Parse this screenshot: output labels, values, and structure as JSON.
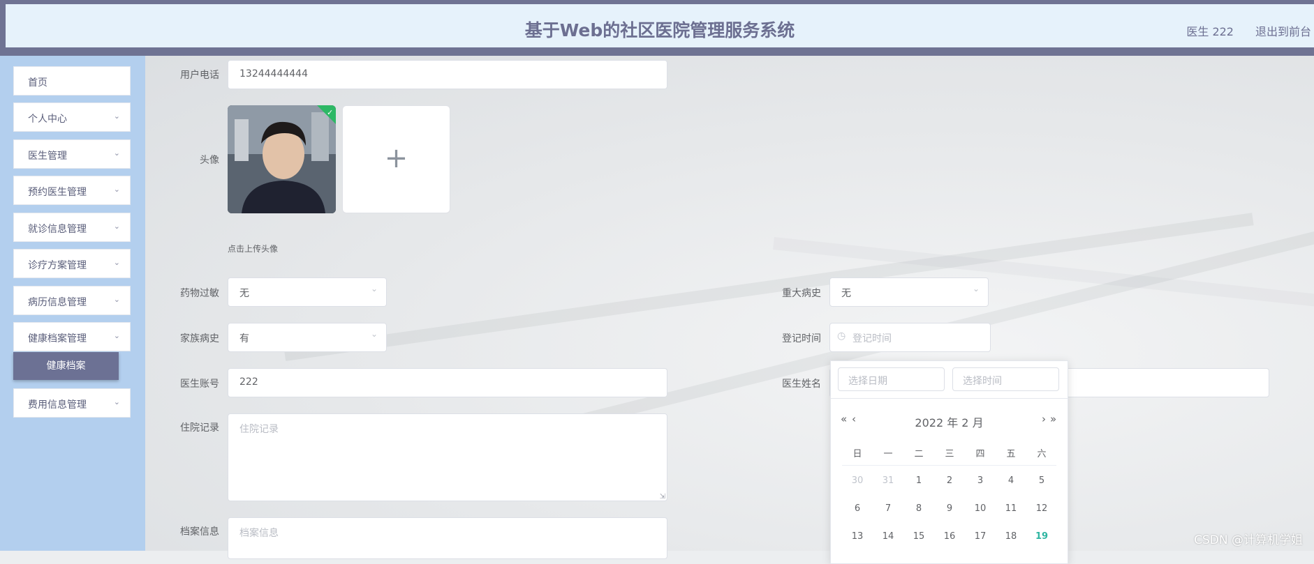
{
  "header": {
    "title": "基于Web的社区医院管理服务系统",
    "user": "医生 222",
    "logout": "退出到前台"
  },
  "sidebar": {
    "items": [
      {
        "label": "首页",
        "expandable": false
      },
      {
        "label": "个人中心",
        "expandable": true
      },
      {
        "label": "医生管理",
        "expandable": true
      },
      {
        "label": "预约医生管理",
        "expandable": true
      },
      {
        "label": "就诊信息管理",
        "expandable": true
      },
      {
        "label": "诊疗方案管理",
        "expandable": true
      },
      {
        "label": "病历信息管理",
        "expandable": true
      },
      {
        "label": "健康档案管理",
        "expandable": true
      },
      {
        "label": "费用信息管理",
        "expandable": true
      }
    ],
    "active_sub": "健康档案"
  },
  "form": {
    "phone": {
      "label": "用户电话",
      "value": "13244444444"
    },
    "avatar": {
      "label": "头像",
      "hint": "点击上传头像"
    },
    "allergy": {
      "label": "药物过敏",
      "value": "无"
    },
    "major_history": {
      "label": "重大病史",
      "value": "无"
    },
    "family_history": {
      "label": "家族病史",
      "value": "有"
    },
    "register_time": {
      "label": "登记时间",
      "placeholder": "登记时间"
    },
    "doctor_account": {
      "label": "医生账号",
      "value": "222"
    },
    "doctor_name": {
      "label": "医生姓名",
      "value": ""
    },
    "hospital_record": {
      "label": "住院记录",
      "placeholder": "住院记录"
    },
    "archive_info": {
      "label": "档案信息",
      "placeholder": "档案信息"
    }
  },
  "datepicker": {
    "date_placeholder": "选择日期",
    "time_placeholder": "选择时间",
    "month_label": "2022 年  2 月",
    "weekdays": [
      "日",
      "一",
      "二",
      "三",
      "四",
      "五",
      "六"
    ],
    "rows": [
      [
        "30",
        "31",
        "1",
        "2",
        "3",
        "4",
        "5"
      ],
      [
        "6",
        "7",
        "8",
        "9",
        "10",
        "11",
        "12"
      ],
      [
        "13",
        "14",
        "15",
        "16",
        "17",
        "18",
        "19"
      ]
    ],
    "today": "19",
    "colors": {
      "today": "#2eb5a1"
    }
  },
  "watermark": "CSDN @计算机学姐",
  "colors": {
    "header_text": "#6c6f91",
    "sidebar_bg": "#b3cfee",
    "active_sub": "#6c7194"
  }
}
